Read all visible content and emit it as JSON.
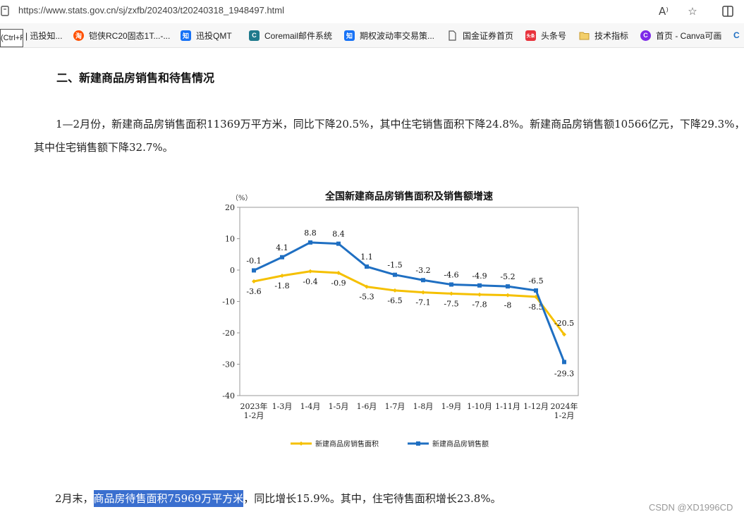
{
  "browser": {
    "url": "https://www.stats.gov.cn/sj/zxfb/202403/t20240318_1948497.html",
    "tooltip": "(Ctrl+R)",
    "bookmarks": [
      {
        "label": "| 迅投知...",
        "icon": "zhihu-icon",
        "color": "#1772f6"
      },
      {
        "label": "铠侠RC20固态1T...-...",
        "icon": "taobao-icon",
        "color": "#ff5000"
      },
      {
        "label": "迅投QMT",
        "icon": "zhihu-icon",
        "color": "#1772f6"
      },
      {
        "label": "Coremail邮件系统",
        "icon": "coremail-icon",
        "color": "#1f7a8c"
      },
      {
        "label": "期权波动率交易策...",
        "icon": "zhihu-icon",
        "color": "#1772f6"
      },
      {
        "label": "国金证券首页",
        "icon": "page-icon",
        "color": "#555555"
      },
      {
        "label": "头条号",
        "icon": "toutiao-icon",
        "color": "#e8323c"
      },
      {
        "label": "技术指标",
        "icon": "folder-icon",
        "color": "#e8b64a"
      },
      {
        "label": "首页 - Canva可画",
        "icon": "canva-icon",
        "color": "#7d2ae8"
      }
    ]
  },
  "article": {
    "heading": "二、新建商品房销售和待售情况",
    "para1": "1—2月份，新建商品房销售面积11369万平方米，同比下降20.5%，其中住宅销售面积下降24.8%。新建商品房销售额10566亿元，下降29.3%，其中住宅销售额下降32.7%。",
    "para2_prefix": "2月末，",
    "para2_highlight": "商品房待售面积75969万平方米",
    "para2_suffix": "，同比增长15.9%。其中，住宅待售面积增长23.8%。"
  },
  "chart_data": {
    "type": "line",
    "title": "全国新建商品房销售面积及销售额增速",
    "unit_label": "（%）",
    "ylim": [
      -40,
      20
    ],
    "yticks": [
      20,
      10,
      0,
      -10,
      -20,
      -30,
      -40
    ],
    "categories": [
      [
        "2023年",
        "1-2月"
      ],
      [
        "1-3月"
      ],
      [
        "1-4月"
      ],
      [
        "1-5月"
      ],
      [
        "1-6月"
      ],
      [
        "1-7月"
      ],
      [
        "1-8月"
      ],
      [
        "1-9月"
      ],
      [
        "1-10月"
      ],
      [
        "1-11月"
      ],
      [
        "1-12月"
      ],
      [
        "2024年",
        "1-2月"
      ]
    ],
    "series": [
      {
        "name": "新建商品房销售面积",
        "color": "#f5c000",
        "values": [
          -3.6,
          -1.8,
          -0.4,
          -0.9,
          -5.3,
          -6.5,
          -7.1,
          -7.5,
          -7.8,
          -8.0,
          -8.5,
          -20.5
        ]
      },
      {
        "name": "新建商品房销售额",
        "color": "#1f6fc2",
        "values": [
          -0.1,
          4.1,
          8.8,
          8.4,
          1.1,
          -1.5,
          -3.2,
          -4.6,
          -4.9,
          -5.2,
          -6.5,
          -29.3
        ]
      }
    ],
    "legend": "bottom",
    "grid": false
  },
  "watermark": "CSDN @XD1996CD"
}
